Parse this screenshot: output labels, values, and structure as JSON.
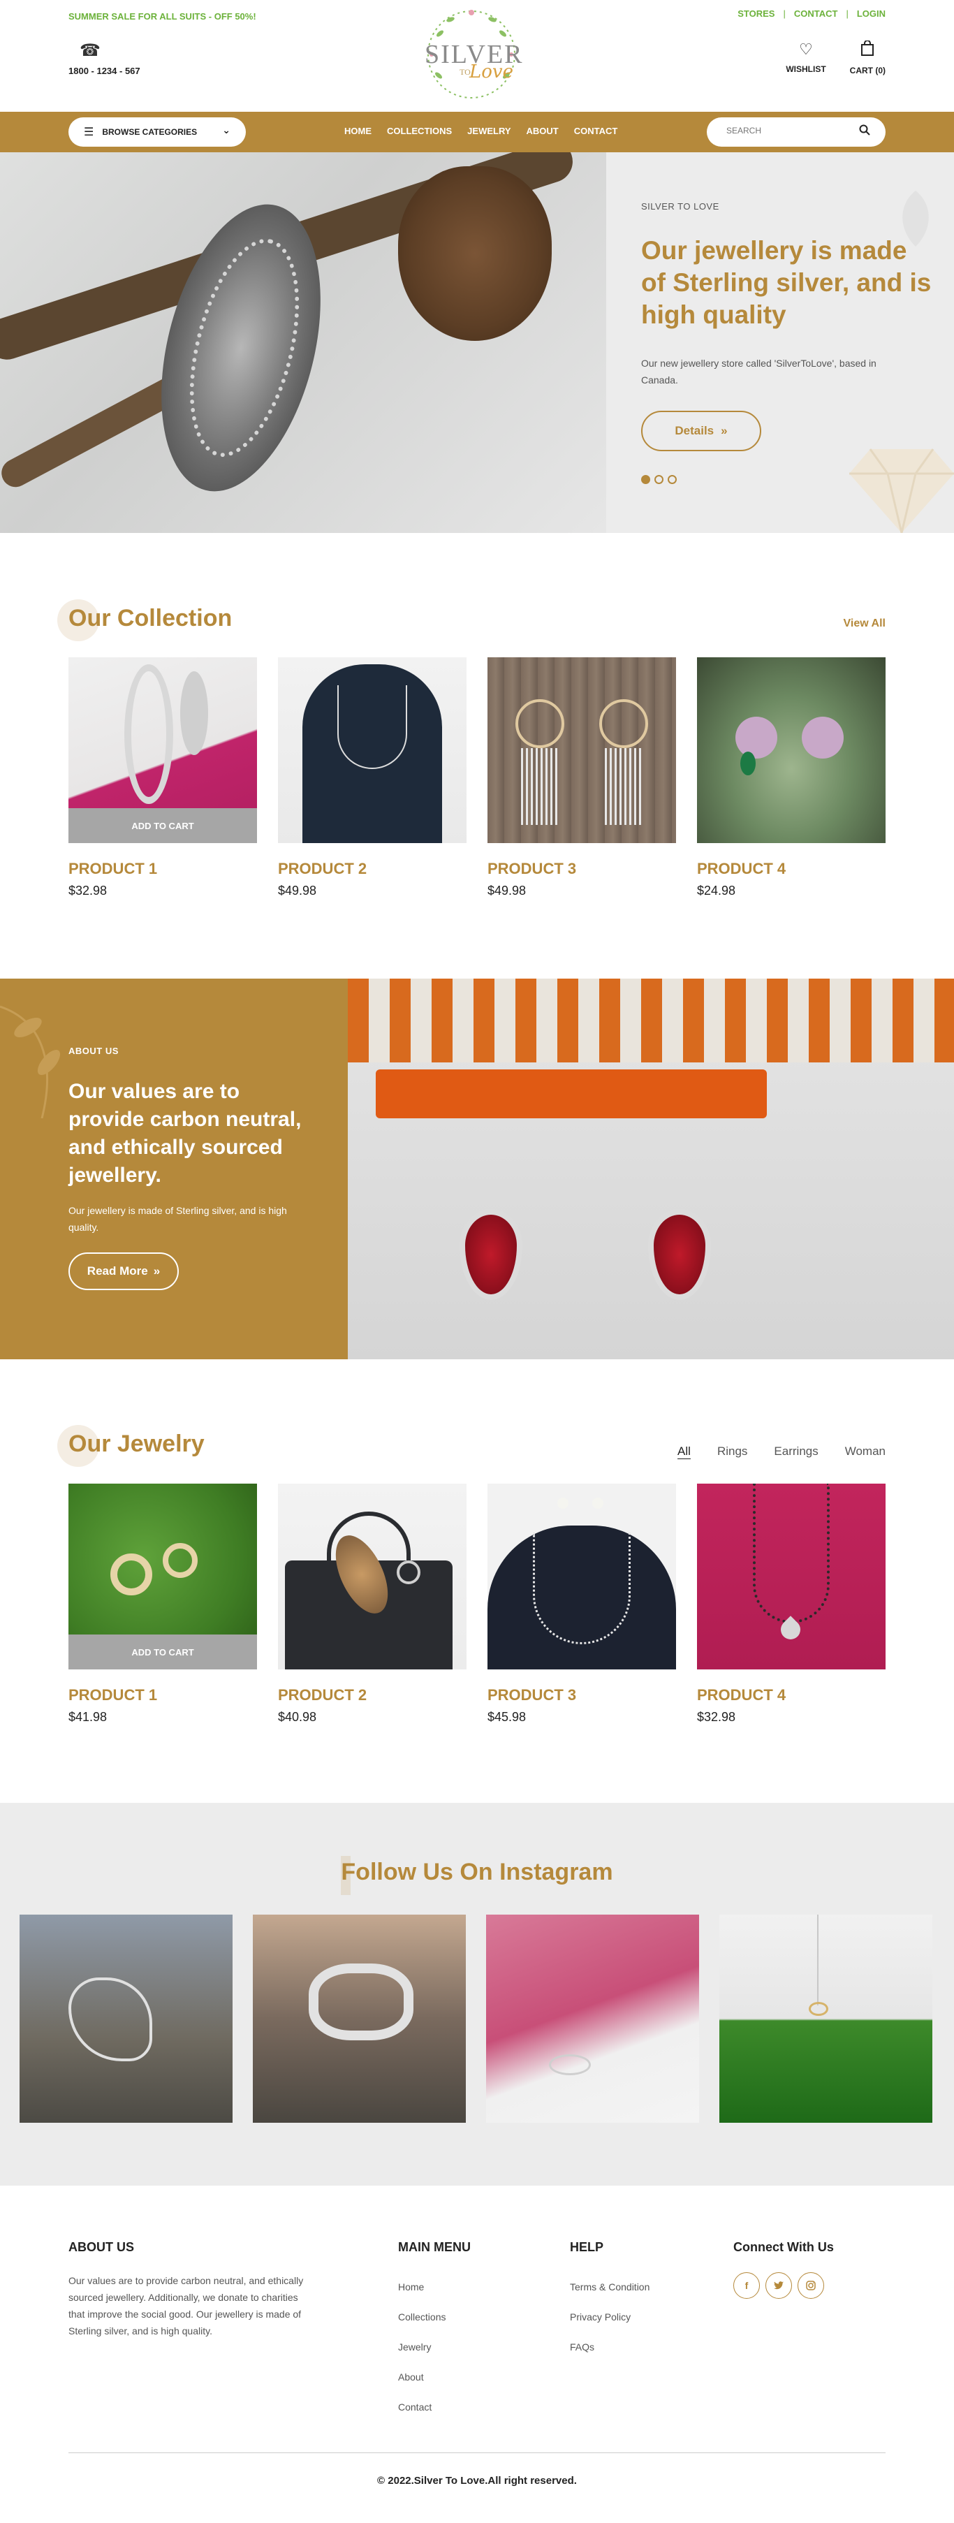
{
  "header": {
    "promo": "SUMMER SALE FOR ALL SUITS - OFF 50%!",
    "top_links": [
      "STORES",
      "CONTACT",
      "LOGIN"
    ],
    "phone": "1800 - 1234 - 567",
    "logo_word": "SILVER",
    "logo_to": "TO",
    "logo_love": "Love",
    "wishlist": "WISHLIST",
    "cart": "CART (0)"
  },
  "nav": {
    "browse_label": "BROWSE CATEGORIES",
    "links": [
      "HOME",
      "COLLECTIONS",
      "JEWELRY",
      "ABOUT",
      "CONTACT"
    ],
    "search_placeholder": "SEARCH"
  },
  "hero": {
    "kicker": "SILVER TO LOVE",
    "title": "Our jewellery is made of Sterling silver, and is high quality",
    "description": "Our new jewellery store called 'SilverToLove', based in Canada.",
    "button": "Details",
    "slides_total": 3,
    "active_slide": 1
  },
  "collection": {
    "title": "Our Collection",
    "view_all": "View All",
    "add_to_cart": "ADD TO CART",
    "products": [
      {
        "name": "PRODUCT 1",
        "price": "$32.98"
      },
      {
        "name": "PRODUCT 2",
        "price": "$49.98"
      },
      {
        "name": "PRODUCT 3",
        "price": "$49.98"
      },
      {
        "name": "PRODUCT 4",
        "price": "$24.98"
      }
    ]
  },
  "about": {
    "kicker": "ABOUT US",
    "title": "Our values are to provide carbon neutral, and ethically sourced jewellery.",
    "description": "Our jewellery is made of Sterling silver, and is high quality.",
    "button": "Read More"
  },
  "jewelry": {
    "title": "Our Jewelry",
    "tabs": [
      "All",
      "Rings",
      "Earrings",
      "Woman"
    ],
    "active_tab": "All",
    "add_to_cart": "ADD TO CART",
    "products": [
      {
        "name": "PRODUCT 1",
        "price": "$41.98"
      },
      {
        "name": "PRODUCT 2",
        "price": "$40.98"
      },
      {
        "name": "PRODUCT 3",
        "price": "$45.98"
      },
      {
        "name": "PRODUCT 4",
        "price": "$32.98"
      }
    ]
  },
  "instagram": {
    "title": "Follow Us On Instagram"
  },
  "footer": {
    "about_title": "ABOUT US",
    "about_text": "Our values are to provide carbon neutral, and ethically sourced jewellery. Additionally, we donate to charities that improve the social good. Our jewellery is made of Sterling silver, and is high quality.",
    "menu_title": "MAIN MENU",
    "menu_items": [
      "Home",
      "Collections",
      "Jewelry",
      "About",
      "Contact"
    ],
    "help_title": "HELP",
    "help_items": [
      "Terms & Condition",
      "Privacy Policy",
      "FAQs"
    ],
    "connect_title": "Connect With Us",
    "socials": [
      "facebook-icon",
      "twitter-icon",
      "instagram-icon"
    ],
    "copyright": "© 2022.Silver To Love.All right reserved."
  },
  "colors": {
    "accent": "#b5893b",
    "promo_green": "#6cb23b",
    "light_bg": "#ececec"
  }
}
